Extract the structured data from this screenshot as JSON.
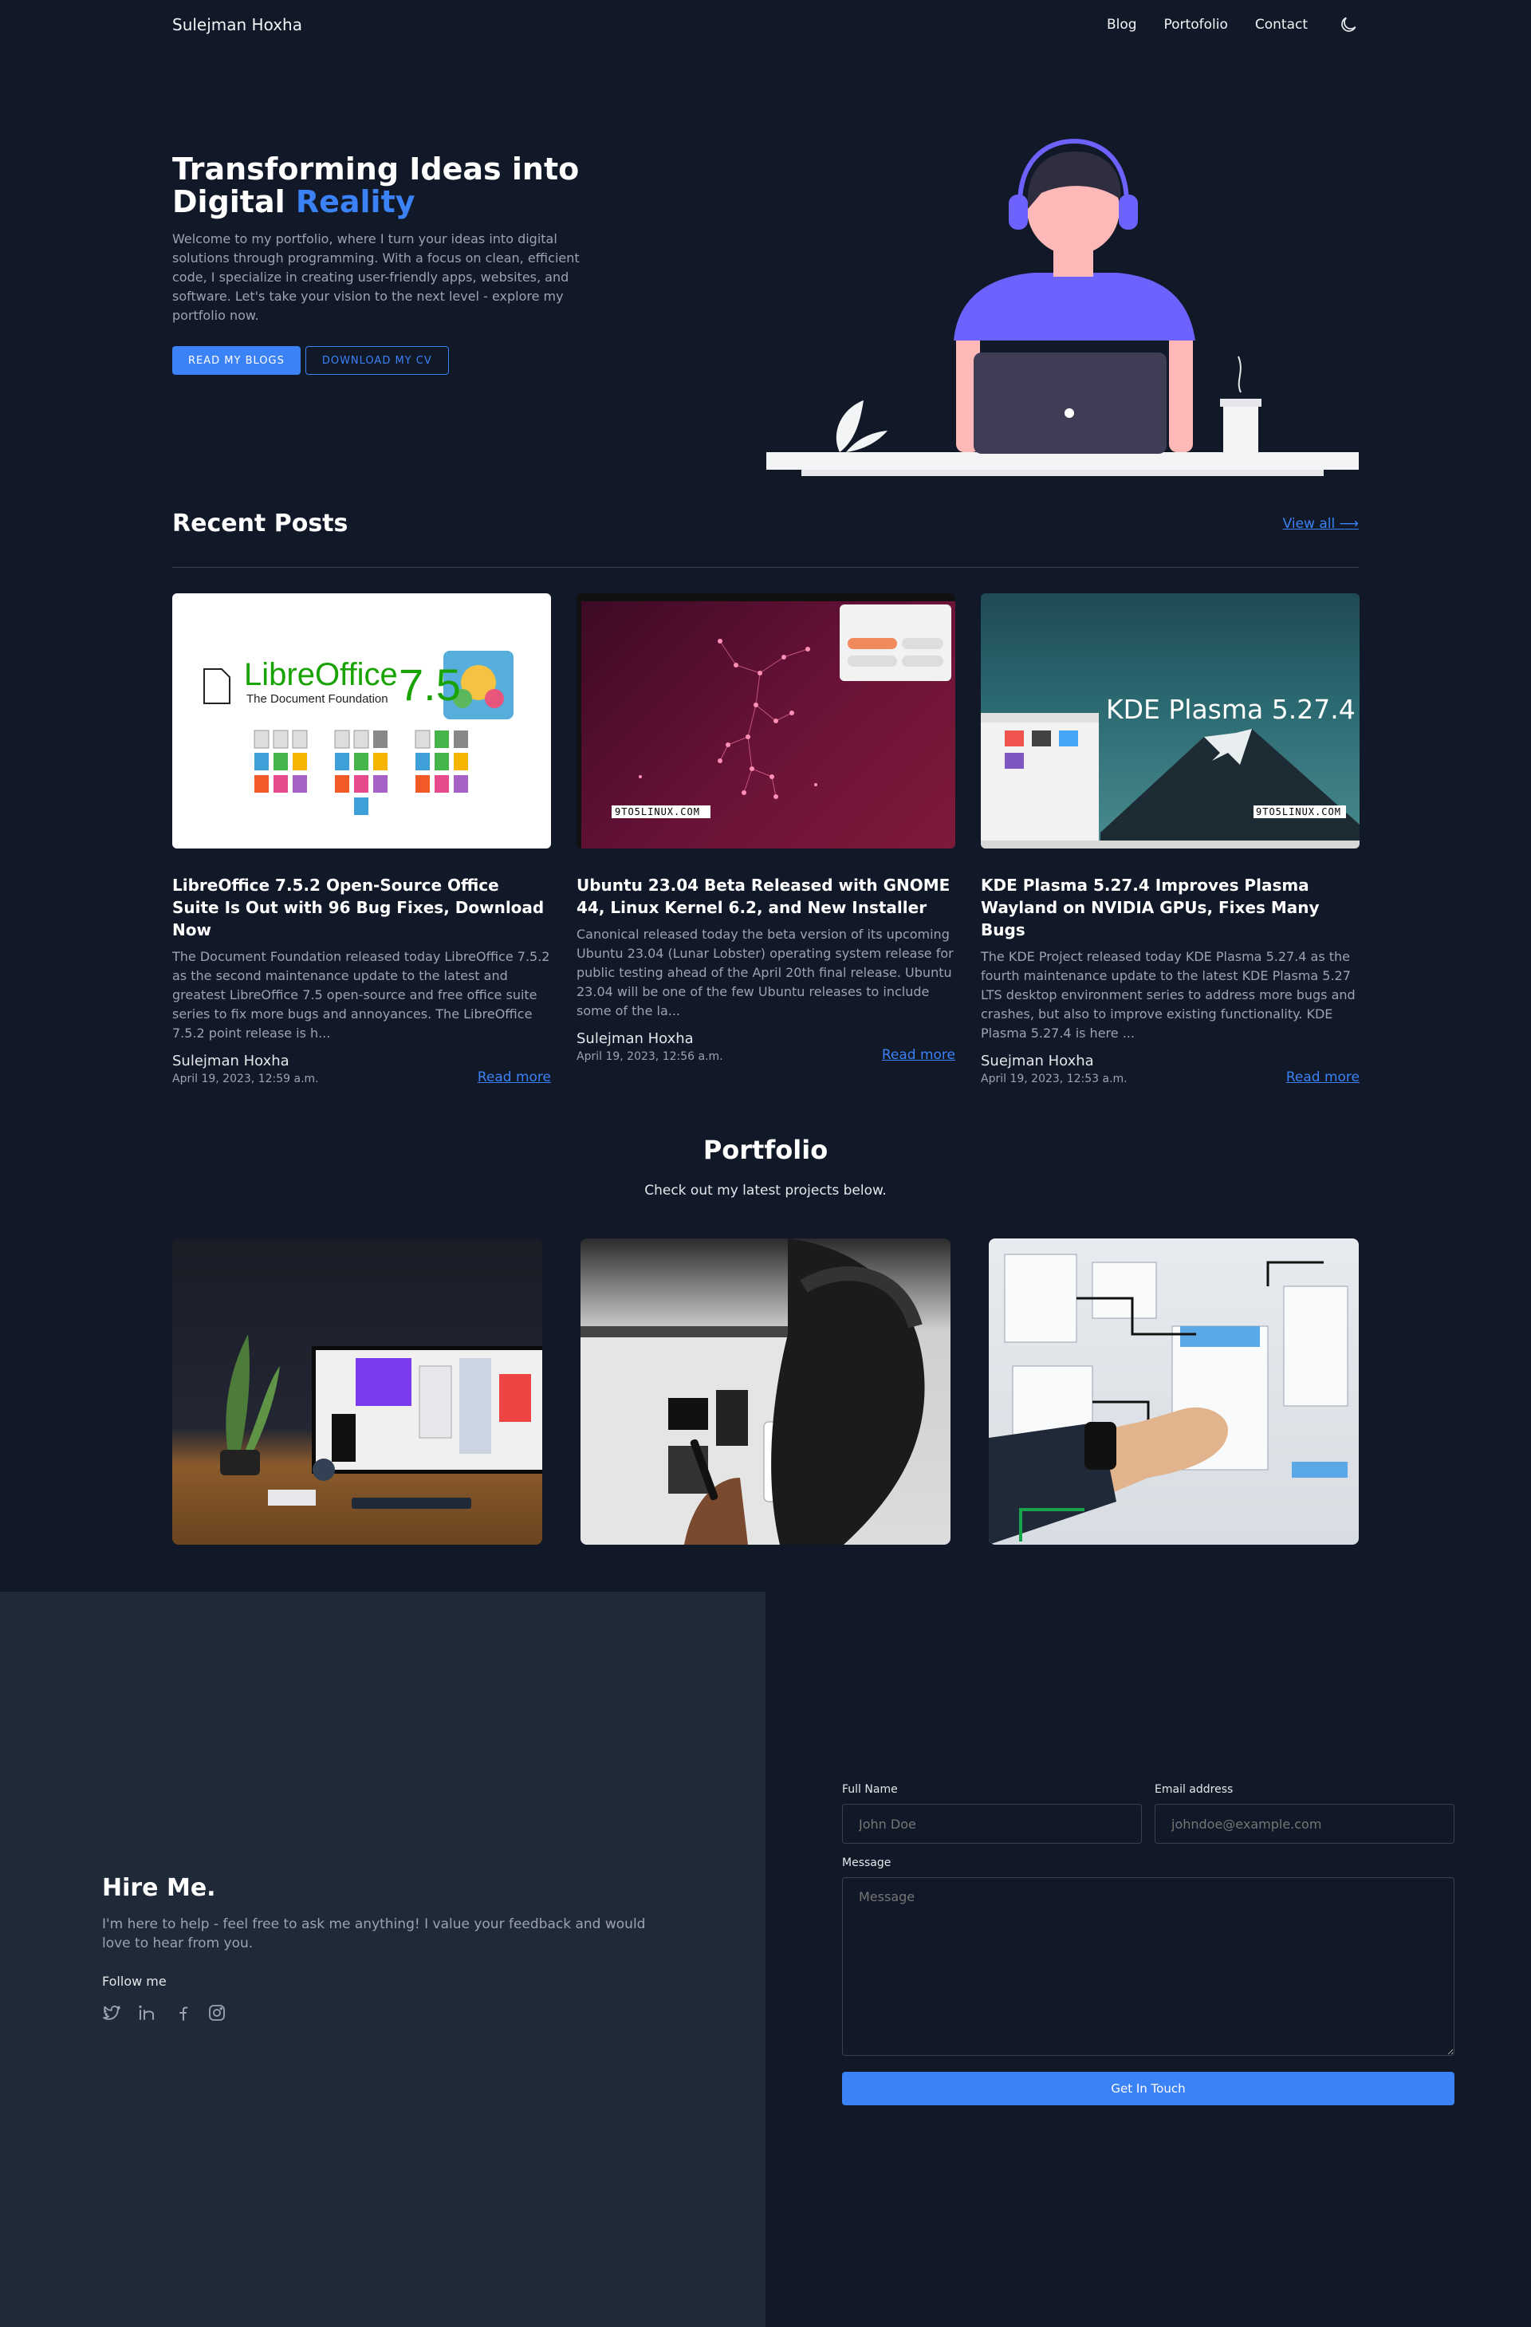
{
  "nav": {
    "brand": "Sulejman Hoxha",
    "links": [
      "Blog",
      "Portofolio",
      "Contact"
    ],
    "theme_icon": "moon-icon"
  },
  "hero": {
    "title_part1": "Transforming Ideas into Digital ",
    "title_accent": "Reality",
    "description": "Welcome to my portfolio, where I turn your ideas into digital solutions through programming. With a focus on clean, efficient code, I specialize in creating user-friendly apps, websites, and software. Let's take your vision to the next level - explore my portfolio now.",
    "btn_blogs": "READ MY BLOGS",
    "btn_cv": "DOWNLOAD MY CV",
    "accent_color": "#3b82f6"
  },
  "recent_posts": {
    "title": "Recent Posts",
    "view_all": "View all ⟶",
    "posts": [
      {
        "title": "LibreOffice 7.5.2 Open-Source Office Suite Is Out with 96 Bug Fixes, Download Now",
        "excerpt": "The Document Foundation released today LibreOffice 7.5.2 as the second maintenance update to the latest and greatest LibreOffice 7.5 open-source and free office suite series to fix more bugs and annoyances. The LibreOffice 7.5.2 point release is h...",
        "author": "Sulejman Hoxha",
        "date": "April 19, 2023, 12:59 a.m.",
        "read_more": "Read more",
        "image_brand": "LibreOffice",
        "image_sub": "The Document Foundation",
        "image_version": "7.5"
      },
      {
        "title": "Ubuntu 23.04 Beta Released with GNOME 44, Linux Kernel 6.2, and New Installer",
        "excerpt": "Canonical released today the beta version of its upcoming Ubuntu 23.04 (Lunar Lobster) operating system release for public testing ahead of the April 20th final release. Ubuntu 23.04 will be one of the few Ubuntu releases to include some of the la...",
        "author": "Sulejman Hoxha",
        "date": "April 19, 2023, 12:56 a.m.",
        "read_more": "Read more",
        "image_watermark": "9TO5LINUX.COM"
      },
      {
        "title": "KDE Plasma 5.27.4 Improves Plasma Wayland on NVIDIA GPUs, Fixes Many Bugs",
        "excerpt": "The KDE Project released today KDE Plasma 5.27.4 as the fourth maintenance update to the latest KDE Plasma 5.27 LTS desktop environment series to address more bugs and crashes, but also to improve existing functionality. KDE Plasma 5.27.4 is here ...",
        "author": "Suejman Hoxha",
        "date": "April 19, 2023, 12:53 a.m.",
        "read_more": "Read more",
        "image_title": "KDE Plasma 5.27.4",
        "image_watermark": "9TO5LINUX.COM"
      }
    ]
  },
  "portfolio": {
    "title": "Portfolio",
    "subtitle": "Check out my latest projects below."
  },
  "hire": {
    "title": "Hire Me.",
    "description": "I'm here to help - feel free to ask me anything! I value your feedback and would love to hear from you.",
    "follow": "Follow me",
    "socials": [
      "twitter-icon",
      "linkedin-icon",
      "facebook-icon",
      "instagram-icon"
    ]
  },
  "form": {
    "name_label": "Full Name",
    "name_placeholder": "John Doe",
    "email_label": "Email address",
    "email_placeholder": "johndoe@example.com",
    "message_label": "Message",
    "message_placeholder": "Message",
    "submit": "Get In Touch"
  }
}
